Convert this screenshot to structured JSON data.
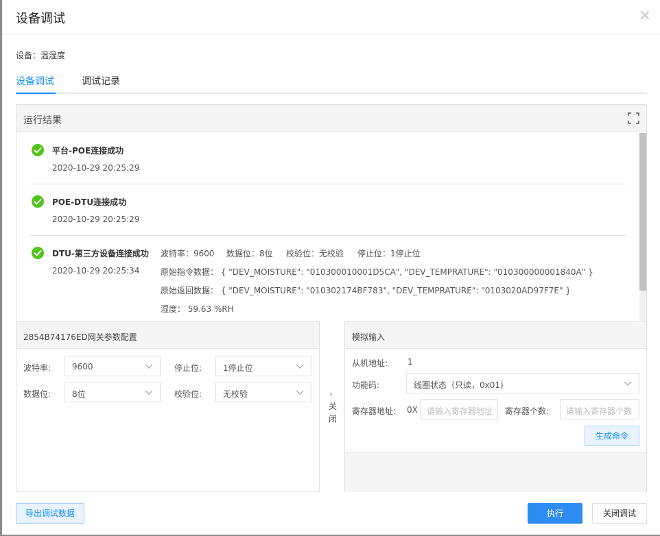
{
  "dialog": {
    "title": "设备调试",
    "close_icon": "×"
  },
  "device": {
    "label": "设备：温湿度"
  },
  "tabs": [
    {
      "label": "设备调试",
      "active": true
    },
    {
      "label": "调试记录",
      "active": false
    }
  ],
  "results": {
    "title": "运行结果",
    "items": [
      {
        "title": "平台-POE连接成功",
        "time": "2020-10-29 20:25:29"
      },
      {
        "title": "POE-DTU连接成功",
        "time": "2020-10-29 20:25:29"
      },
      {
        "title": "DTU-第三方设备连接成功",
        "time": "2020-10-29 20:25:34",
        "baud": "波特率：9600",
        "databits": "数据位：8位",
        "parity": "校验位：无校验",
        "stopbits": "停止位：1停止位",
        "raw_cmd": "原始指令数据：  { \"DEV_MOISTURE\": \"010300010001D5CA\", \"DEV_TEMPRATURE\": \"010300000001840A\" }",
        "raw_ret": "原始返回数据：  { \"DEV_MOISTURE\": \"010302174BF783\", \"DEV_TEMPRATURE\": \"0103020AD97F7E\" }",
        "humidity": "湿度：  59.63 %RH"
      }
    ]
  },
  "gateway": {
    "title": "2854B74176ED网关参数配置",
    "baud_label": "波特率:",
    "baud_value": "9600",
    "stop_label": "停止位:",
    "stop_value": "1停止位",
    "data_label": "数据位:",
    "data_value": "8位",
    "parity_label": "校验位:",
    "parity_value": "无校验"
  },
  "toggle": {
    "arrow": "›",
    "char1": "关",
    "char2": "闭"
  },
  "sim": {
    "title": "模拟输入",
    "slave_label": "从机地址:",
    "slave_value": "1",
    "func_label": "功能码:",
    "func_value": "线圈状态（只读，0x01)",
    "reg_addr_label": "寄存器地址:",
    "reg_prefix": "0X",
    "reg_addr_placeholder": "请输入寄存器地址",
    "reg_count_label": "寄存器个数:",
    "reg_count_placeholder": "请输入寄存器个数",
    "generate_label": "生成命令"
  },
  "footer": {
    "export_label": "导出调试数据",
    "execute_label": "执行",
    "close_label": "关闭调试"
  },
  "colors": {
    "primary": "#2d8cf0",
    "success": "#52c41a",
    "tab_active": "#1890ff"
  }
}
